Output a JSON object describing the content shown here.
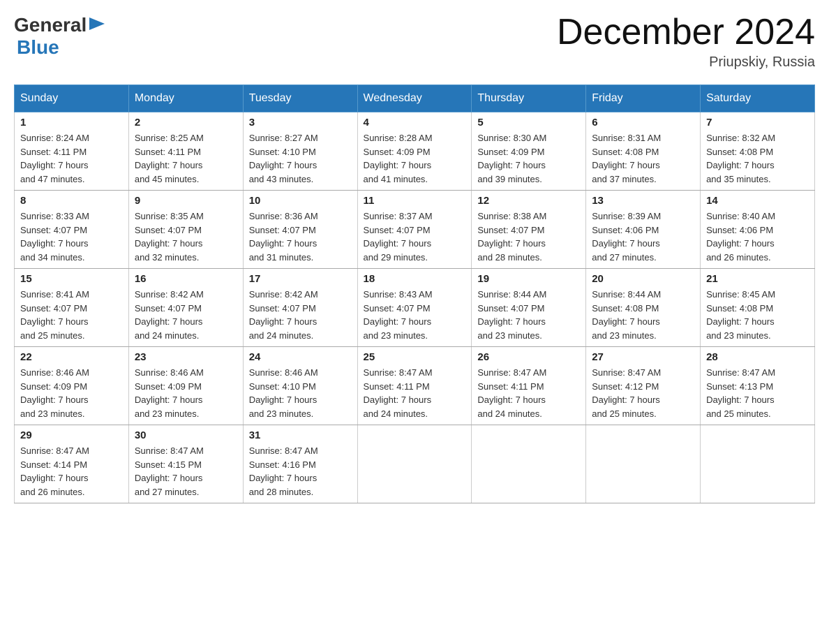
{
  "header": {
    "logo_general": "General",
    "logo_blue": "Blue",
    "month_title": "December 2024",
    "location": "Priupskiy, Russia"
  },
  "days_of_week": [
    "Sunday",
    "Monday",
    "Tuesday",
    "Wednesday",
    "Thursday",
    "Friday",
    "Saturday"
  ],
  "weeks": [
    [
      {
        "day": "1",
        "sunrise": "8:24 AM",
        "sunset": "4:11 PM",
        "daylight": "7 hours and 47 minutes."
      },
      {
        "day": "2",
        "sunrise": "8:25 AM",
        "sunset": "4:11 PM",
        "daylight": "7 hours and 45 minutes."
      },
      {
        "day": "3",
        "sunrise": "8:27 AM",
        "sunset": "4:10 PM",
        "daylight": "7 hours and 43 minutes."
      },
      {
        "day": "4",
        "sunrise": "8:28 AM",
        "sunset": "4:09 PM",
        "daylight": "7 hours and 41 minutes."
      },
      {
        "day": "5",
        "sunrise": "8:30 AM",
        "sunset": "4:09 PM",
        "daylight": "7 hours and 39 minutes."
      },
      {
        "day": "6",
        "sunrise": "8:31 AM",
        "sunset": "4:08 PM",
        "daylight": "7 hours and 37 minutes."
      },
      {
        "day": "7",
        "sunrise": "8:32 AM",
        "sunset": "4:08 PM",
        "daylight": "7 hours and 35 minutes."
      }
    ],
    [
      {
        "day": "8",
        "sunrise": "8:33 AM",
        "sunset": "4:07 PM",
        "daylight": "7 hours and 34 minutes."
      },
      {
        "day": "9",
        "sunrise": "8:35 AM",
        "sunset": "4:07 PM",
        "daylight": "7 hours and 32 minutes."
      },
      {
        "day": "10",
        "sunrise": "8:36 AM",
        "sunset": "4:07 PM",
        "daylight": "7 hours and 31 minutes."
      },
      {
        "day": "11",
        "sunrise": "8:37 AM",
        "sunset": "4:07 PM",
        "daylight": "7 hours and 29 minutes."
      },
      {
        "day": "12",
        "sunrise": "8:38 AM",
        "sunset": "4:07 PM",
        "daylight": "7 hours and 28 minutes."
      },
      {
        "day": "13",
        "sunrise": "8:39 AM",
        "sunset": "4:06 PM",
        "daylight": "7 hours and 27 minutes."
      },
      {
        "day": "14",
        "sunrise": "8:40 AM",
        "sunset": "4:06 PM",
        "daylight": "7 hours and 26 minutes."
      }
    ],
    [
      {
        "day": "15",
        "sunrise": "8:41 AM",
        "sunset": "4:07 PM",
        "daylight": "7 hours and 25 minutes."
      },
      {
        "day": "16",
        "sunrise": "8:42 AM",
        "sunset": "4:07 PM",
        "daylight": "7 hours and 24 minutes."
      },
      {
        "day": "17",
        "sunrise": "8:42 AM",
        "sunset": "4:07 PM",
        "daylight": "7 hours and 24 minutes."
      },
      {
        "day": "18",
        "sunrise": "8:43 AM",
        "sunset": "4:07 PM",
        "daylight": "7 hours and 23 minutes."
      },
      {
        "day": "19",
        "sunrise": "8:44 AM",
        "sunset": "4:07 PM",
        "daylight": "7 hours and 23 minutes."
      },
      {
        "day": "20",
        "sunrise": "8:44 AM",
        "sunset": "4:08 PM",
        "daylight": "7 hours and 23 minutes."
      },
      {
        "day": "21",
        "sunrise": "8:45 AM",
        "sunset": "4:08 PM",
        "daylight": "7 hours and 23 minutes."
      }
    ],
    [
      {
        "day": "22",
        "sunrise": "8:46 AM",
        "sunset": "4:09 PM",
        "daylight": "7 hours and 23 minutes."
      },
      {
        "day": "23",
        "sunrise": "8:46 AM",
        "sunset": "4:09 PM",
        "daylight": "7 hours and 23 minutes."
      },
      {
        "day": "24",
        "sunrise": "8:46 AM",
        "sunset": "4:10 PM",
        "daylight": "7 hours and 23 minutes."
      },
      {
        "day": "25",
        "sunrise": "8:47 AM",
        "sunset": "4:11 PM",
        "daylight": "7 hours and 24 minutes."
      },
      {
        "day": "26",
        "sunrise": "8:47 AM",
        "sunset": "4:11 PM",
        "daylight": "7 hours and 24 minutes."
      },
      {
        "day": "27",
        "sunrise": "8:47 AM",
        "sunset": "4:12 PM",
        "daylight": "7 hours and 25 minutes."
      },
      {
        "day": "28",
        "sunrise": "8:47 AM",
        "sunset": "4:13 PM",
        "daylight": "7 hours and 25 minutes."
      }
    ],
    [
      {
        "day": "29",
        "sunrise": "8:47 AM",
        "sunset": "4:14 PM",
        "daylight": "7 hours and 26 minutes."
      },
      {
        "day": "30",
        "sunrise": "8:47 AM",
        "sunset": "4:15 PM",
        "daylight": "7 hours and 27 minutes."
      },
      {
        "day": "31",
        "sunrise": "8:47 AM",
        "sunset": "4:16 PM",
        "daylight": "7 hours and 28 minutes."
      },
      null,
      null,
      null,
      null
    ]
  ],
  "labels": {
    "sunrise": "Sunrise:",
    "sunset": "Sunset:",
    "daylight": "Daylight:"
  }
}
